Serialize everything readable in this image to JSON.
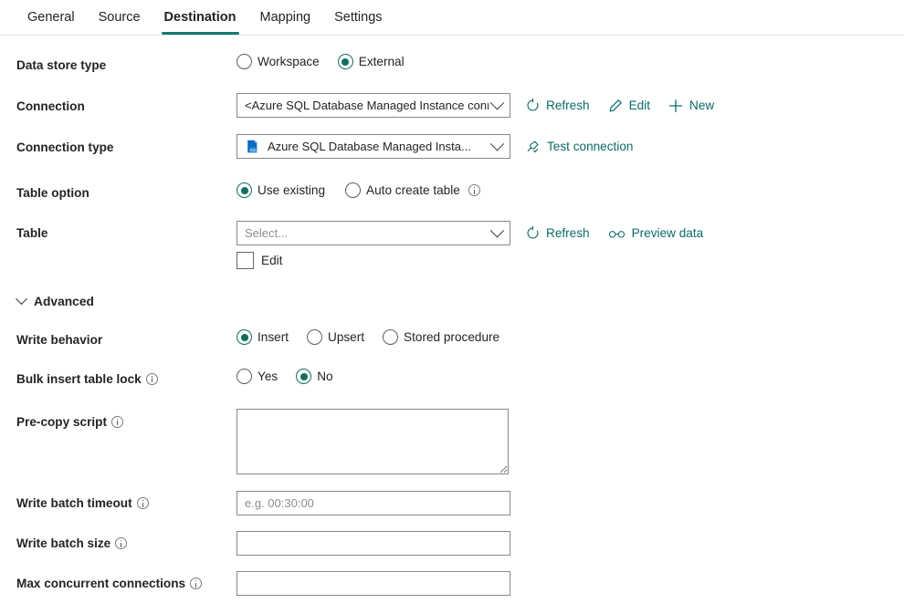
{
  "tabs": [
    {
      "label": "General",
      "active": false
    },
    {
      "label": "Source",
      "active": false
    },
    {
      "label": "Destination",
      "active": true
    },
    {
      "label": "Mapping",
      "active": false
    },
    {
      "label": "Settings",
      "active": false
    }
  ],
  "accent": "#107c6e",
  "link_color": "#0b6a6a",
  "rows": {
    "data_store_type": {
      "label": "Data store type",
      "options": [
        "Workspace",
        "External"
      ],
      "selected": "External"
    },
    "connection": {
      "label": "Connection",
      "value": "<Azure SQL Database Managed Instance connection>",
      "actions": [
        "Refresh",
        "Edit",
        "New"
      ]
    },
    "connection_type": {
      "label": "Connection type",
      "value": "Azure SQL Database Managed Insta...",
      "icon": "azure-sql-database-icon",
      "action": "Test connection"
    },
    "table_option": {
      "label": "Table option",
      "options": [
        "Use existing",
        "Auto create table"
      ],
      "selected": "Use existing"
    },
    "table": {
      "label": "Table",
      "placeholder": "Select...",
      "value": "",
      "edit_label": "Edit",
      "edit_checked": false,
      "actions": [
        "Refresh",
        "Preview data"
      ]
    },
    "advanced": {
      "label": "Advanced",
      "expanded": true
    },
    "write_behavior": {
      "label": "Write behavior",
      "options": [
        "Insert",
        "Upsert",
        "Stored procedure"
      ],
      "selected": "Insert"
    },
    "bulk_insert_table_lock": {
      "label": "Bulk insert table lock",
      "options": [
        "Yes",
        "No"
      ],
      "selected": "No",
      "has_info": true
    },
    "pre_copy_script": {
      "label": "Pre-copy script",
      "value": "",
      "placeholder": "",
      "has_info": true
    },
    "write_batch_timeout": {
      "label": "Write batch timeout",
      "value": "",
      "placeholder": "e.g. 00:30:00",
      "has_info": true
    },
    "write_batch_size": {
      "label": "Write batch size",
      "value": "",
      "placeholder": "",
      "has_info": true
    },
    "max_concurrent_connections": {
      "label": "Max concurrent connections",
      "value": "",
      "placeholder": "",
      "has_info": true
    }
  }
}
